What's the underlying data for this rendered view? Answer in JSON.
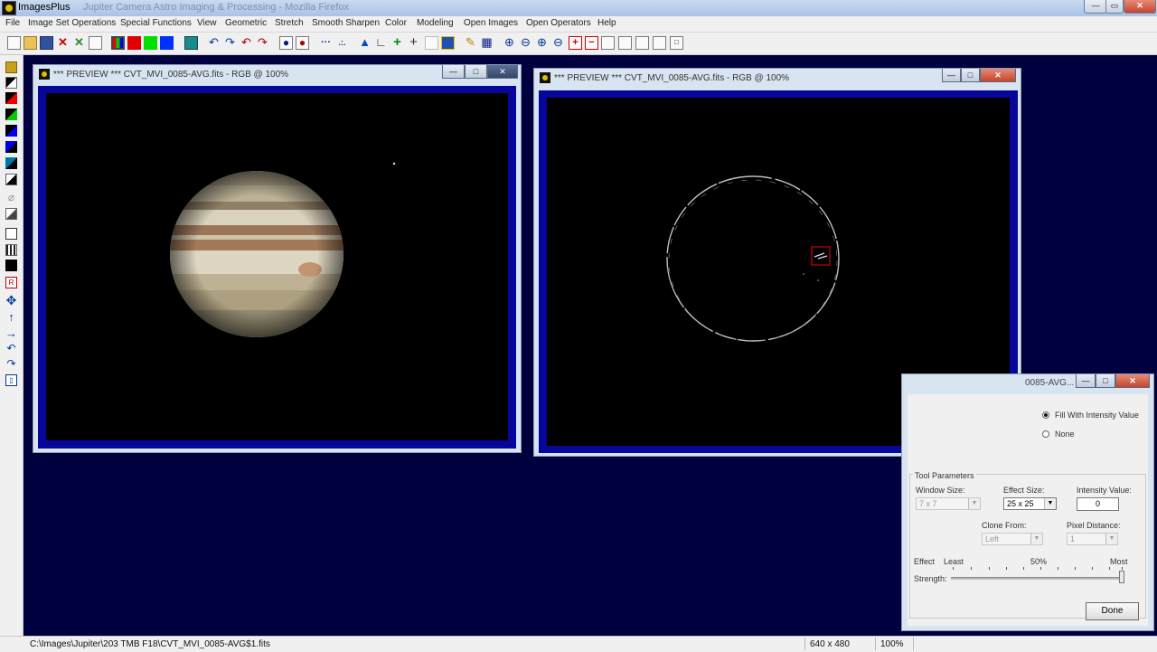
{
  "app": {
    "title": "ImagesPlus",
    "ghost_title": "Jupiter Camera Astro Imaging & Processing - Mozilla Firefox"
  },
  "menu": [
    "File",
    "Image Set Operations",
    "Special Functions",
    "View",
    "Geometric",
    "Stretch",
    "Smooth Sharpen",
    "Color",
    "Modeling",
    "Open Images",
    "Open Operators",
    "Help"
  ],
  "windows": {
    "left": {
      "title": "*** PREVIEW *** CVT_MVI_0085-AVG.fits - RGB @ 100%"
    },
    "right": {
      "title": "*** PREVIEW *** CVT_MVI_0085-AVG.fits - RGB @ 100%"
    }
  },
  "dialog": {
    "title_fragment": "0085-AVG...",
    "radio_fill": "Fill With Intensity Value",
    "radio_none": "None",
    "group_title": "Tool Parameters",
    "window_size_label": "Window Size:",
    "window_size_value": "7 x 7",
    "effect_size_label": "Effect Size:",
    "effect_size_value": "25 x 25",
    "intensity_label": "Intensity Value:",
    "intensity_value": "0",
    "clone_from_label": "Clone From:",
    "clone_from_value": "Left",
    "pixel_distance_label": "Pixel Distance:",
    "pixel_distance_value": "1",
    "effect_label": "Effect",
    "strength_label": "Strength:",
    "least": "Least",
    "mid": "50%",
    "most": "Most",
    "strength_fraction": 1.0,
    "done_label": "Done"
  },
  "status": {
    "path": "C:\\Images\\Jupiter\\203 TMB F18\\CVT_MVI_0085-AVG$1.fits",
    "dimensions": "640 x 480",
    "zoom": "100%"
  },
  "colors": {
    "workspace": "#00003e",
    "frame_blue": "#06069a",
    "title_bar": "#c9daf0"
  }
}
